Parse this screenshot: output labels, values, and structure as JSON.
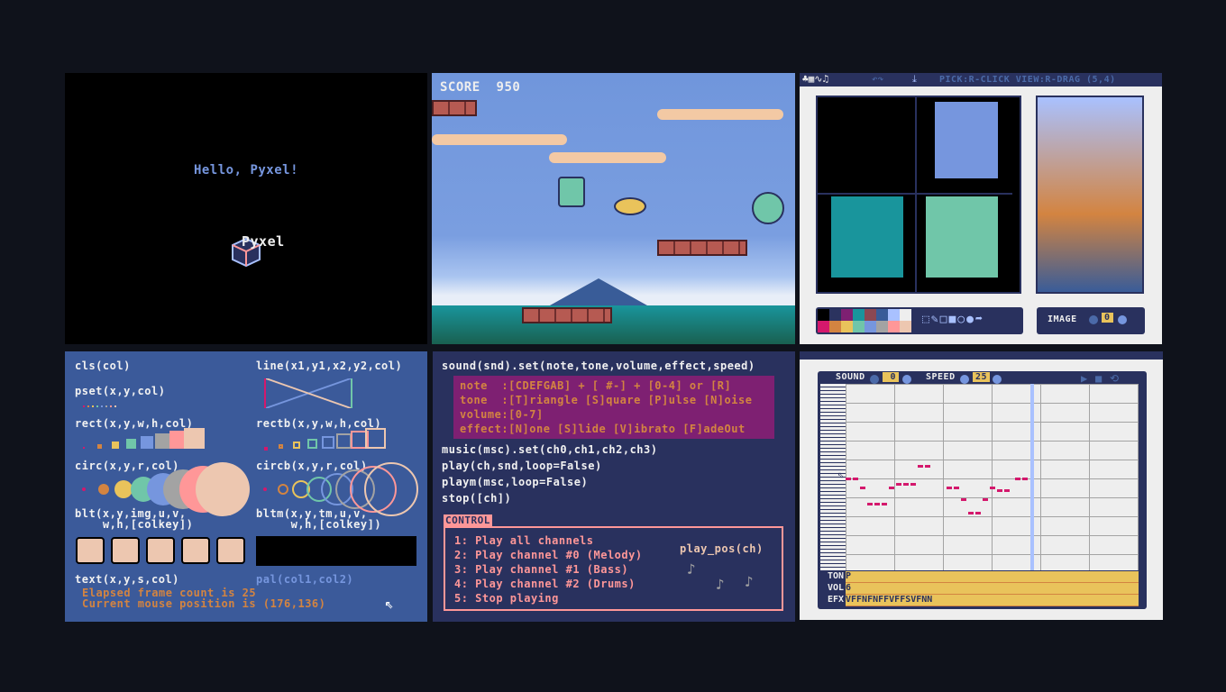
{
  "hello": {
    "greeting": "Hello, Pyxel!",
    "logo_text": "Pyxel"
  },
  "game": {
    "score_label": "SCORE",
    "score": "950"
  },
  "image_editor": {
    "toolbar_hint": "PICK:R-CLICK VIEW:R-DRAG (5,4)",
    "image_label": "IMAGE",
    "image_value": "0",
    "palette": [
      "#000000",
      "#2b335f",
      "#7e2072",
      "#19959c",
      "#8b4852",
      "#395c98",
      "#a9c1ff",
      "#eeeeee",
      "#d4186c",
      "#d38441",
      "#e9c35b",
      "#70c6a9",
      "#7696de",
      "#a3a3a3",
      "#ff9798",
      "#edc7b0"
    ]
  },
  "api_draw": {
    "cls": "cls(col)",
    "line": "line(x1,y1,x2,y2,col)",
    "pset": "pset(x,y,col)",
    "rect": "rect(x,y,w,h,col)",
    "rectb": "rectb(x,y,w,h,col)",
    "circ": "circ(x,y,r,col)",
    "circb": "circb(x,y,r,col)",
    "blt1": "blt(x,y,img,u,v,",
    "blt2": "    w,h,[colkey])",
    "bltm1": "bltm(x,y,tm,u,v,",
    "bltm2": "     w,h,[colkey])",
    "text": "text(x,y,s,col)",
    "pal": "pal(col1,col2)",
    "frame_line": "Elapsed frame count is 25",
    "mouse_line": "Current mouse position is (176,136)"
  },
  "api_sound": {
    "sound_set": "sound(snd).set(note,tone,volume,effect,speed)",
    "note": "note  :[CDEFGAB] + [ #-] + [0-4] or [R]",
    "tone": "tone  :[T]riangle [S]quare [P]ulse [N]oise",
    "volume": "volume:[0-7]",
    "effect": "effect:[N]one [S]lide [V]ibrato [F]adeOut",
    "music_set": "music(msc).set(ch0,ch1,ch2,ch3)",
    "play": "play(ch,snd,loop=False)",
    "playm": "playm(msc,loop=False)",
    "stop": "stop([ch])",
    "control_label": "CONTROL",
    "controls": [
      "1: Play all channels",
      "2: Play channel #0 (Melody)",
      "3: Play channel #1 (Bass)",
      "4: Play channel #2 (Drums)",
      "5: Stop playing"
    ],
    "play_pos": "play_pos(ch)"
  },
  "sound_editor": {
    "sound_label": "SOUND",
    "sound_value": "0",
    "speed_label": "SPEED",
    "speed_value": "25",
    "rows": [
      {
        "label": "TON",
        "value": "P"
      },
      {
        "label": "VOL",
        "value": "6"
      },
      {
        "label": "EFX",
        "value": "VFFNFNFFVFFSVFNN"
      }
    ]
  }
}
